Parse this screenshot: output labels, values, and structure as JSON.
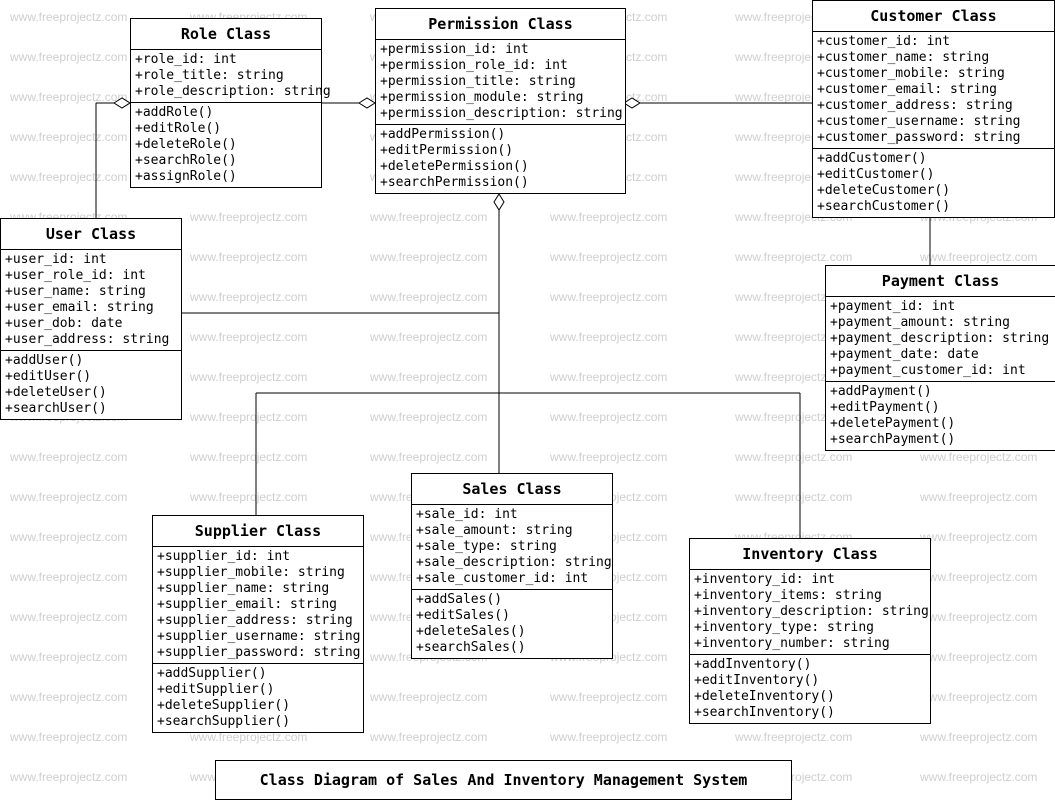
{
  "watermark": "www.freeprojectz.com",
  "diagram_title": "Class Diagram of Sales And Inventory Management System",
  "classes": {
    "role": {
      "name": "Role Class",
      "attrs": [
        "+role_id: int",
        "+role_title: string",
        "+role_description: string"
      ],
      "ops": [
        "+addRole()",
        "+editRole()",
        "+deleteRole()",
        "+searchRole()",
        "+assignRole()"
      ]
    },
    "permission": {
      "name": "Permission Class",
      "attrs": [
        "+permission_id: int",
        "+permission_role_id: int",
        "+permission_title: string",
        "+permission_module: string",
        "+permission_description: string"
      ],
      "ops": [
        "+addPermission()",
        "+editPermission()",
        "+deletePermission()",
        "+searchPermission()"
      ]
    },
    "customer": {
      "name": "Customer Class",
      "attrs": [
        "+customer_id: int",
        "+customer_name: string",
        "+customer_mobile: string",
        "+customer_email: string",
        "+customer_address: string",
        "+customer_username: string",
        "+customer_password: string"
      ],
      "ops": [
        "+addCustomer()",
        "+editCustomer()",
        "+deleteCustomer()",
        "+searchCustomer()"
      ]
    },
    "user": {
      "name": "User Class",
      "attrs": [
        "+user_id: int",
        "+user_role_id: int",
        "+user_name: string",
        "+user_email: string",
        "+user_dob: date",
        "+user_address: string"
      ],
      "ops": [
        "+addUser()",
        "+editUser()",
        "+deleteUser()",
        "+searchUser()"
      ]
    },
    "payment": {
      "name": "Payment Class",
      "attrs": [
        "+payment_id: int",
        "+payment_amount: string",
        "+payment_description: string",
        "+payment_date: date",
        "+payment_customer_id: int"
      ],
      "ops": [
        "+addPayment()",
        "+editPayment()",
        "+deletePayment()",
        "+searchPayment()"
      ]
    },
    "sales": {
      "name": "Sales Class",
      "attrs": [
        "+sale_id: int",
        "+sale_amount: string",
        "+sale_type: string",
        "+sale_description: string",
        "+sale_customer_id: int"
      ],
      "ops": [
        "+addSales()",
        "+editSales()",
        "+deleteSales()",
        "+searchSales()"
      ]
    },
    "supplier": {
      "name": "Supplier Class",
      "attrs": [
        "+supplier_id: int",
        "+supplier_mobile: string",
        "+supplier_name: string",
        "+supplier_email: string",
        "+supplier_address: string",
        "+supplier_username: string",
        "+supplier_password: string"
      ],
      "ops": [
        "+addSupplier()",
        "+editSupplier()",
        "+deleteSupplier()",
        "+searchSupplier()"
      ]
    },
    "inventory": {
      "name": "Inventory Class",
      "attrs": [
        "+inventory_id: int",
        "+inventory_items: string",
        "+inventory_description: string",
        "+inventory_type: string",
        "+inventory_number: string"
      ],
      "ops": [
        "+addInventory()",
        "+editInventory()",
        "+deleteInventory()",
        "+searchInventory()"
      ]
    }
  }
}
